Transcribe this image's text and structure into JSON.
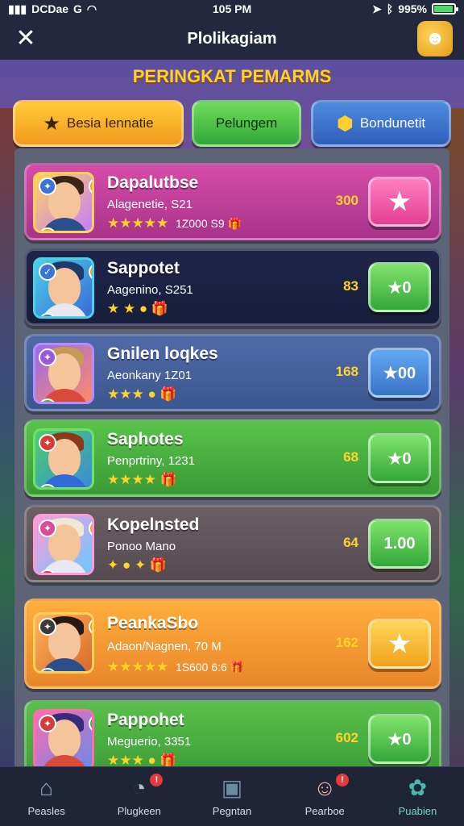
{
  "status_bar": {
    "carrier": "DCDae",
    "network": "G",
    "time": "105 PM",
    "battery": "995%",
    "battery_level_percent": 95
  },
  "top_bar": {
    "title": "Plolikagiam"
  },
  "heading": "PERINGKAT PEMARMS",
  "tabs": [
    {
      "label": "Besia Iennatie",
      "icon": "star-icon",
      "color": "#f39a1e"
    },
    {
      "label": "Pelungem",
      "icon": "",
      "color": "#32a83a"
    },
    {
      "label": "Bondunetit",
      "icon": "shield-icon",
      "color": "#2f5fb8"
    }
  ],
  "rows": [
    {
      "name": "Dapalutbse",
      "sub": "Alagenetie, S21",
      "rewards": "★★★★★",
      "extra": "1Z000 S9 🎁",
      "score": "300",
      "action": "★",
      "action_style": "pink"
    },
    {
      "name": "Sappotet",
      "sub": "Aagenino, S251",
      "rewards": "★ ★ ● 🎁",
      "extra": "",
      "score": "83",
      "action": "★0",
      "action_style": "green"
    },
    {
      "name": "Gnilen loqkes",
      "sub": "Aeonkany 1Z01",
      "rewards": "★★★ ● 🎁",
      "extra": "",
      "score": "168",
      "action": "★00",
      "action_style": "blue"
    },
    {
      "name": "Saphotes",
      "sub": "Penprtriny, 1231",
      "rewards": "★★★★ 🎁",
      "extra": "",
      "score": "68",
      "action": "★0",
      "action_style": "green"
    },
    {
      "name": "Kopelnsted",
      "sub": "Ponoo Mano",
      "rewards": "✦ ● ✦ 🎁",
      "extra": "",
      "score": "64",
      "action": "1.00",
      "action_style": "green"
    },
    {
      "name": "PeankaSbo",
      "sub": "Adaon/Nagnen, 70 M",
      "rewards": "★★★★★",
      "extra": "1S600 6:6 🎁",
      "score": "162",
      "action": "★",
      "action_style": "gold"
    },
    {
      "name": "Pappohet",
      "sub": "Meguerio, 3351",
      "rewards": "★★★ ● 🎁",
      "extra": "",
      "score": "602",
      "action": "★0",
      "action_style": "green"
    }
  ],
  "bottom_nav": [
    {
      "label": "Peasles",
      "icon": "home-icon"
    },
    {
      "label": "Plugkeen",
      "icon": "chat-icon",
      "badge": "!"
    },
    {
      "label": "Pegntan",
      "icon": "bag-icon"
    },
    {
      "label": "Pearboe",
      "icon": "pet-icon",
      "badge": "!"
    },
    {
      "label": "Puabien",
      "icon": "puzzle-icon"
    }
  ]
}
